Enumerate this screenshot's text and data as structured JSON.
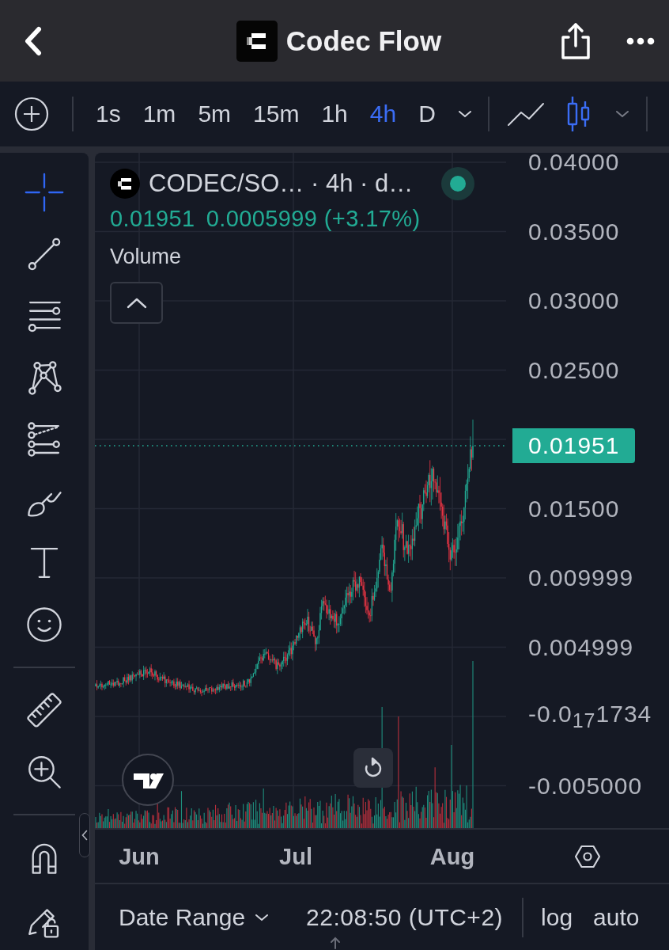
{
  "header": {
    "title": "Codec Flow"
  },
  "toolbar": {
    "intervals": [
      {
        "label": "1s",
        "selected": false
      },
      {
        "label": "1m",
        "selected": false
      },
      {
        "label": "5m",
        "selected": false
      },
      {
        "label": "15m",
        "selected": false
      },
      {
        "label": "1h",
        "selected": false
      },
      {
        "label": "4h",
        "selected": true
      },
      {
        "label": "D",
        "selected": false
      }
    ],
    "chart_styles": [
      {
        "kind": "line",
        "selected": false
      },
      {
        "kind": "candles",
        "selected": true
      }
    ]
  },
  "tool_groups": [
    {
      "tools": [
        {
          "kind": "crosshair",
          "selected": true
        },
        {
          "kind": "trend-line",
          "selected": false
        },
        {
          "kind": "fib-lines",
          "selected": false
        },
        {
          "kind": "pattern",
          "selected": false
        },
        {
          "kind": "forecast",
          "selected": false
        },
        {
          "kind": "brush",
          "selected": false
        },
        {
          "kind": "text",
          "selected": false
        },
        {
          "kind": "emoji",
          "selected": false
        }
      ]
    },
    {
      "tools": [
        {
          "kind": "ruler",
          "selected": false
        },
        {
          "kind": "zoom-in",
          "selected": false
        }
      ]
    },
    {
      "tools": [
        {
          "kind": "magnet",
          "selected": false
        },
        {
          "kind": "lock-drawings",
          "selected": false
        }
      ]
    }
  ],
  "legend": {
    "title": "CODEC/SO… · 4h · d…",
    "market_open": true,
    "last_price": "0.01951",
    "change": "0.0005999 (+3.17%)",
    "indicators": [
      {
        "name": "Volume"
      }
    ],
    "expanded": true
  },
  "price_axis": {
    "labels": [
      {
        "kind": "tick",
        "label": "0.04000"
      },
      {
        "kind": "tick",
        "label": "0.03500"
      },
      {
        "kind": "tick",
        "label": "0.03000"
      },
      {
        "kind": "tick",
        "label": "0.02500"
      },
      {
        "kind": "last-price",
        "label": "0.01951"
      },
      {
        "kind": "tick",
        "label": "0.01500"
      },
      {
        "kind": "tick",
        "label": "0.009999"
      },
      {
        "kind": "tick",
        "label": "0.004999"
      },
      {
        "kind": "tick",
        "label": "-0.0$_{17}$1734"
      },
      {
        "kind": "tick",
        "label": "-0.005000"
      }
    ]
  },
  "time_axis": {
    "labels": [
      "Jun",
      "Jul",
      "Aug"
    ]
  },
  "footer": {
    "date_range": "Date Range",
    "clock": "22:08:50 (UTC+2)",
    "scale_buttons": [
      {
        "label": "log"
      },
      {
        "label": "auto"
      }
    ]
  }
}
